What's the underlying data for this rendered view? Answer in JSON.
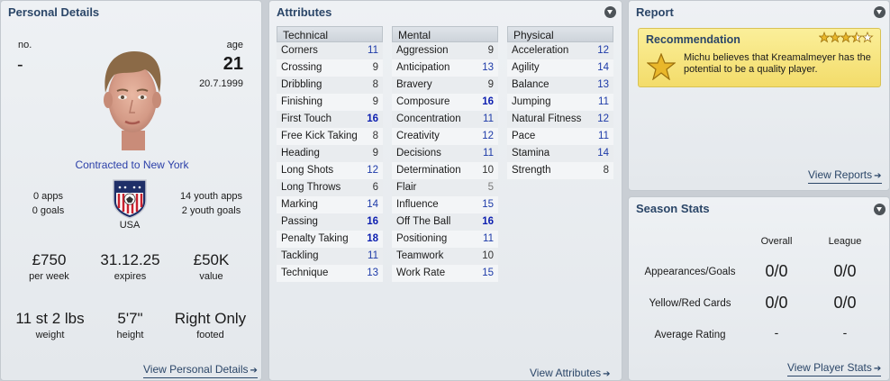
{
  "personal": {
    "title": "Personal Details",
    "no_label": "no.",
    "no_value": "-",
    "age_label": "age",
    "age_value": "21",
    "dob": "20.7.1999",
    "contract": "Contracted to New York",
    "apps": "0 apps",
    "goals": "0 goals",
    "youth_apps": "14 youth apps",
    "youth_goals": "2 youth goals",
    "nation": "USA",
    "wage": "£750",
    "wage_label": "per week",
    "expires": "31.12.25",
    "expires_label": "expires",
    "value": "£50K",
    "value_label": "value",
    "weight": "11 st 2 lbs",
    "weight_label": "weight",
    "height": "5'7\"",
    "height_label": "height",
    "footed": "Right Only",
    "footed_label": "footed",
    "link": "View Personal Details"
  },
  "attributes": {
    "title": "Attributes",
    "link": "View Attributes",
    "technical": {
      "header": "Technical",
      "items": [
        {
          "name": "Corners",
          "value": "11"
        },
        {
          "name": "Crossing",
          "value": "9"
        },
        {
          "name": "Dribbling",
          "value": "8"
        },
        {
          "name": "Finishing",
          "value": "9"
        },
        {
          "name": "First Touch",
          "value": "16"
        },
        {
          "name": "Free Kick Taking",
          "value": "8"
        },
        {
          "name": "Heading",
          "value": "9"
        },
        {
          "name": "Long Shots",
          "value": "12"
        },
        {
          "name": "Long Throws",
          "value": "6"
        },
        {
          "name": "Marking",
          "value": "14"
        },
        {
          "name": "Passing",
          "value": "16"
        },
        {
          "name": "Penalty Taking",
          "value": "18"
        },
        {
          "name": "Tackling",
          "value": "11"
        },
        {
          "name": "Technique",
          "value": "13"
        }
      ]
    },
    "mental": {
      "header": "Mental",
      "items": [
        {
          "name": "Aggression",
          "value": "9"
        },
        {
          "name": "Anticipation",
          "value": "13"
        },
        {
          "name": "Bravery",
          "value": "9"
        },
        {
          "name": "Composure",
          "value": "16"
        },
        {
          "name": "Concentration",
          "value": "11"
        },
        {
          "name": "Creativity",
          "value": "12"
        },
        {
          "name": "Decisions",
          "value": "11"
        },
        {
          "name": "Determination",
          "value": "10"
        },
        {
          "name": "Flair",
          "value": "5"
        },
        {
          "name": "Influence",
          "value": "15"
        },
        {
          "name": "Off The Ball",
          "value": "16"
        },
        {
          "name": "Positioning",
          "value": "11"
        },
        {
          "name": "Teamwork",
          "value": "10"
        },
        {
          "name": "Work Rate",
          "value": "15"
        }
      ]
    },
    "physical": {
      "header": "Physical",
      "items": [
        {
          "name": "Acceleration",
          "value": "12"
        },
        {
          "name": "Agility",
          "value": "14"
        },
        {
          "name": "Balance",
          "value": "13"
        },
        {
          "name": "Jumping",
          "value": "11"
        },
        {
          "name": "Natural Fitness",
          "value": "12"
        },
        {
          "name": "Pace",
          "value": "11"
        },
        {
          "name": "Stamina",
          "value": "14"
        },
        {
          "name": "Strength",
          "value": "8"
        }
      ]
    }
  },
  "report": {
    "title": "Report",
    "rec_title": "Recommendation",
    "stars_filled": 3.5,
    "stars_total": 5,
    "rec_text": "Michu believes that Kreamalmeyer has the potential to be a quality player.",
    "link": "View Reports"
  },
  "season": {
    "title": "Season Stats",
    "col_overall": "Overall",
    "col_league": "League",
    "rows": [
      {
        "label": "Appearances/Goals",
        "overall": "0/0",
        "league": "0/0"
      },
      {
        "label": "Yellow/Red Cards",
        "overall": "0/0",
        "league": "0/0"
      },
      {
        "label": "Average Rating",
        "overall": "-",
        "league": "-"
      }
    ],
    "link": "View Player Stats"
  },
  "colors": {
    "title_blue": "#2b4668",
    "value_blue": "#1d3aa8",
    "recommendation_yellow": "#f7e27e",
    "star_gold": "#e9b72a"
  }
}
